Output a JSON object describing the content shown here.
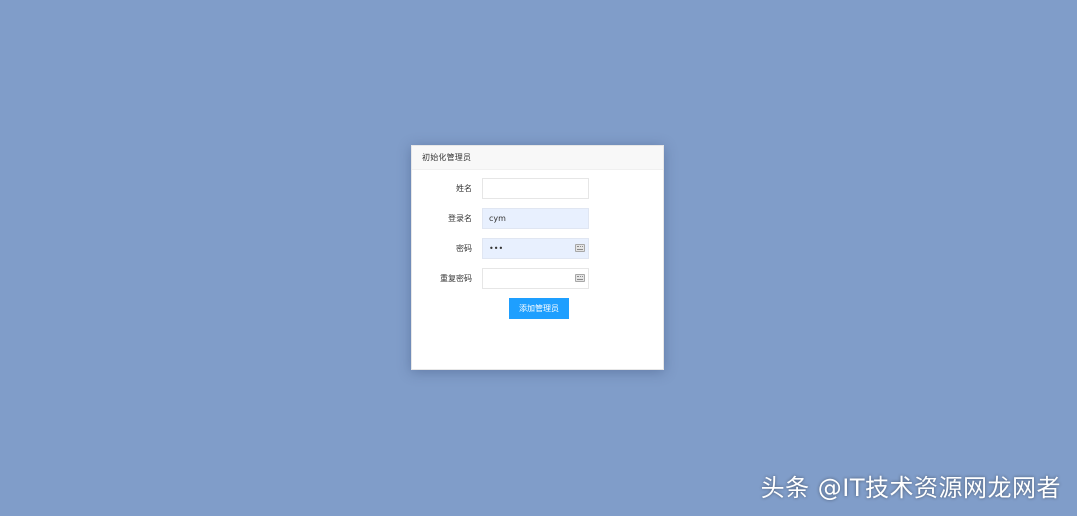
{
  "dialog": {
    "title": "初始化管理员",
    "fields": {
      "name": {
        "label": "姓名",
        "value": ""
      },
      "login": {
        "label": "登录名",
        "value": "cym"
      },
      "password": {
        "label": "密码",
        "value": "•••"
      },
      "repeat_password": {
        "label": "重复密码",
        "value": ""
      }
    },
    "submit_label": "添加管理员"
  },
  "watermark": {
    "text": "头条 @IT技术资源网龙网者"
  },
  "colors": {
    "background": "#809dc9",
    "accent": "#1e9fff",
    "autofill": "#e8f0fe"
  },
  "icons": {
    "password_manager": "keyboard-icon"
  }
}
